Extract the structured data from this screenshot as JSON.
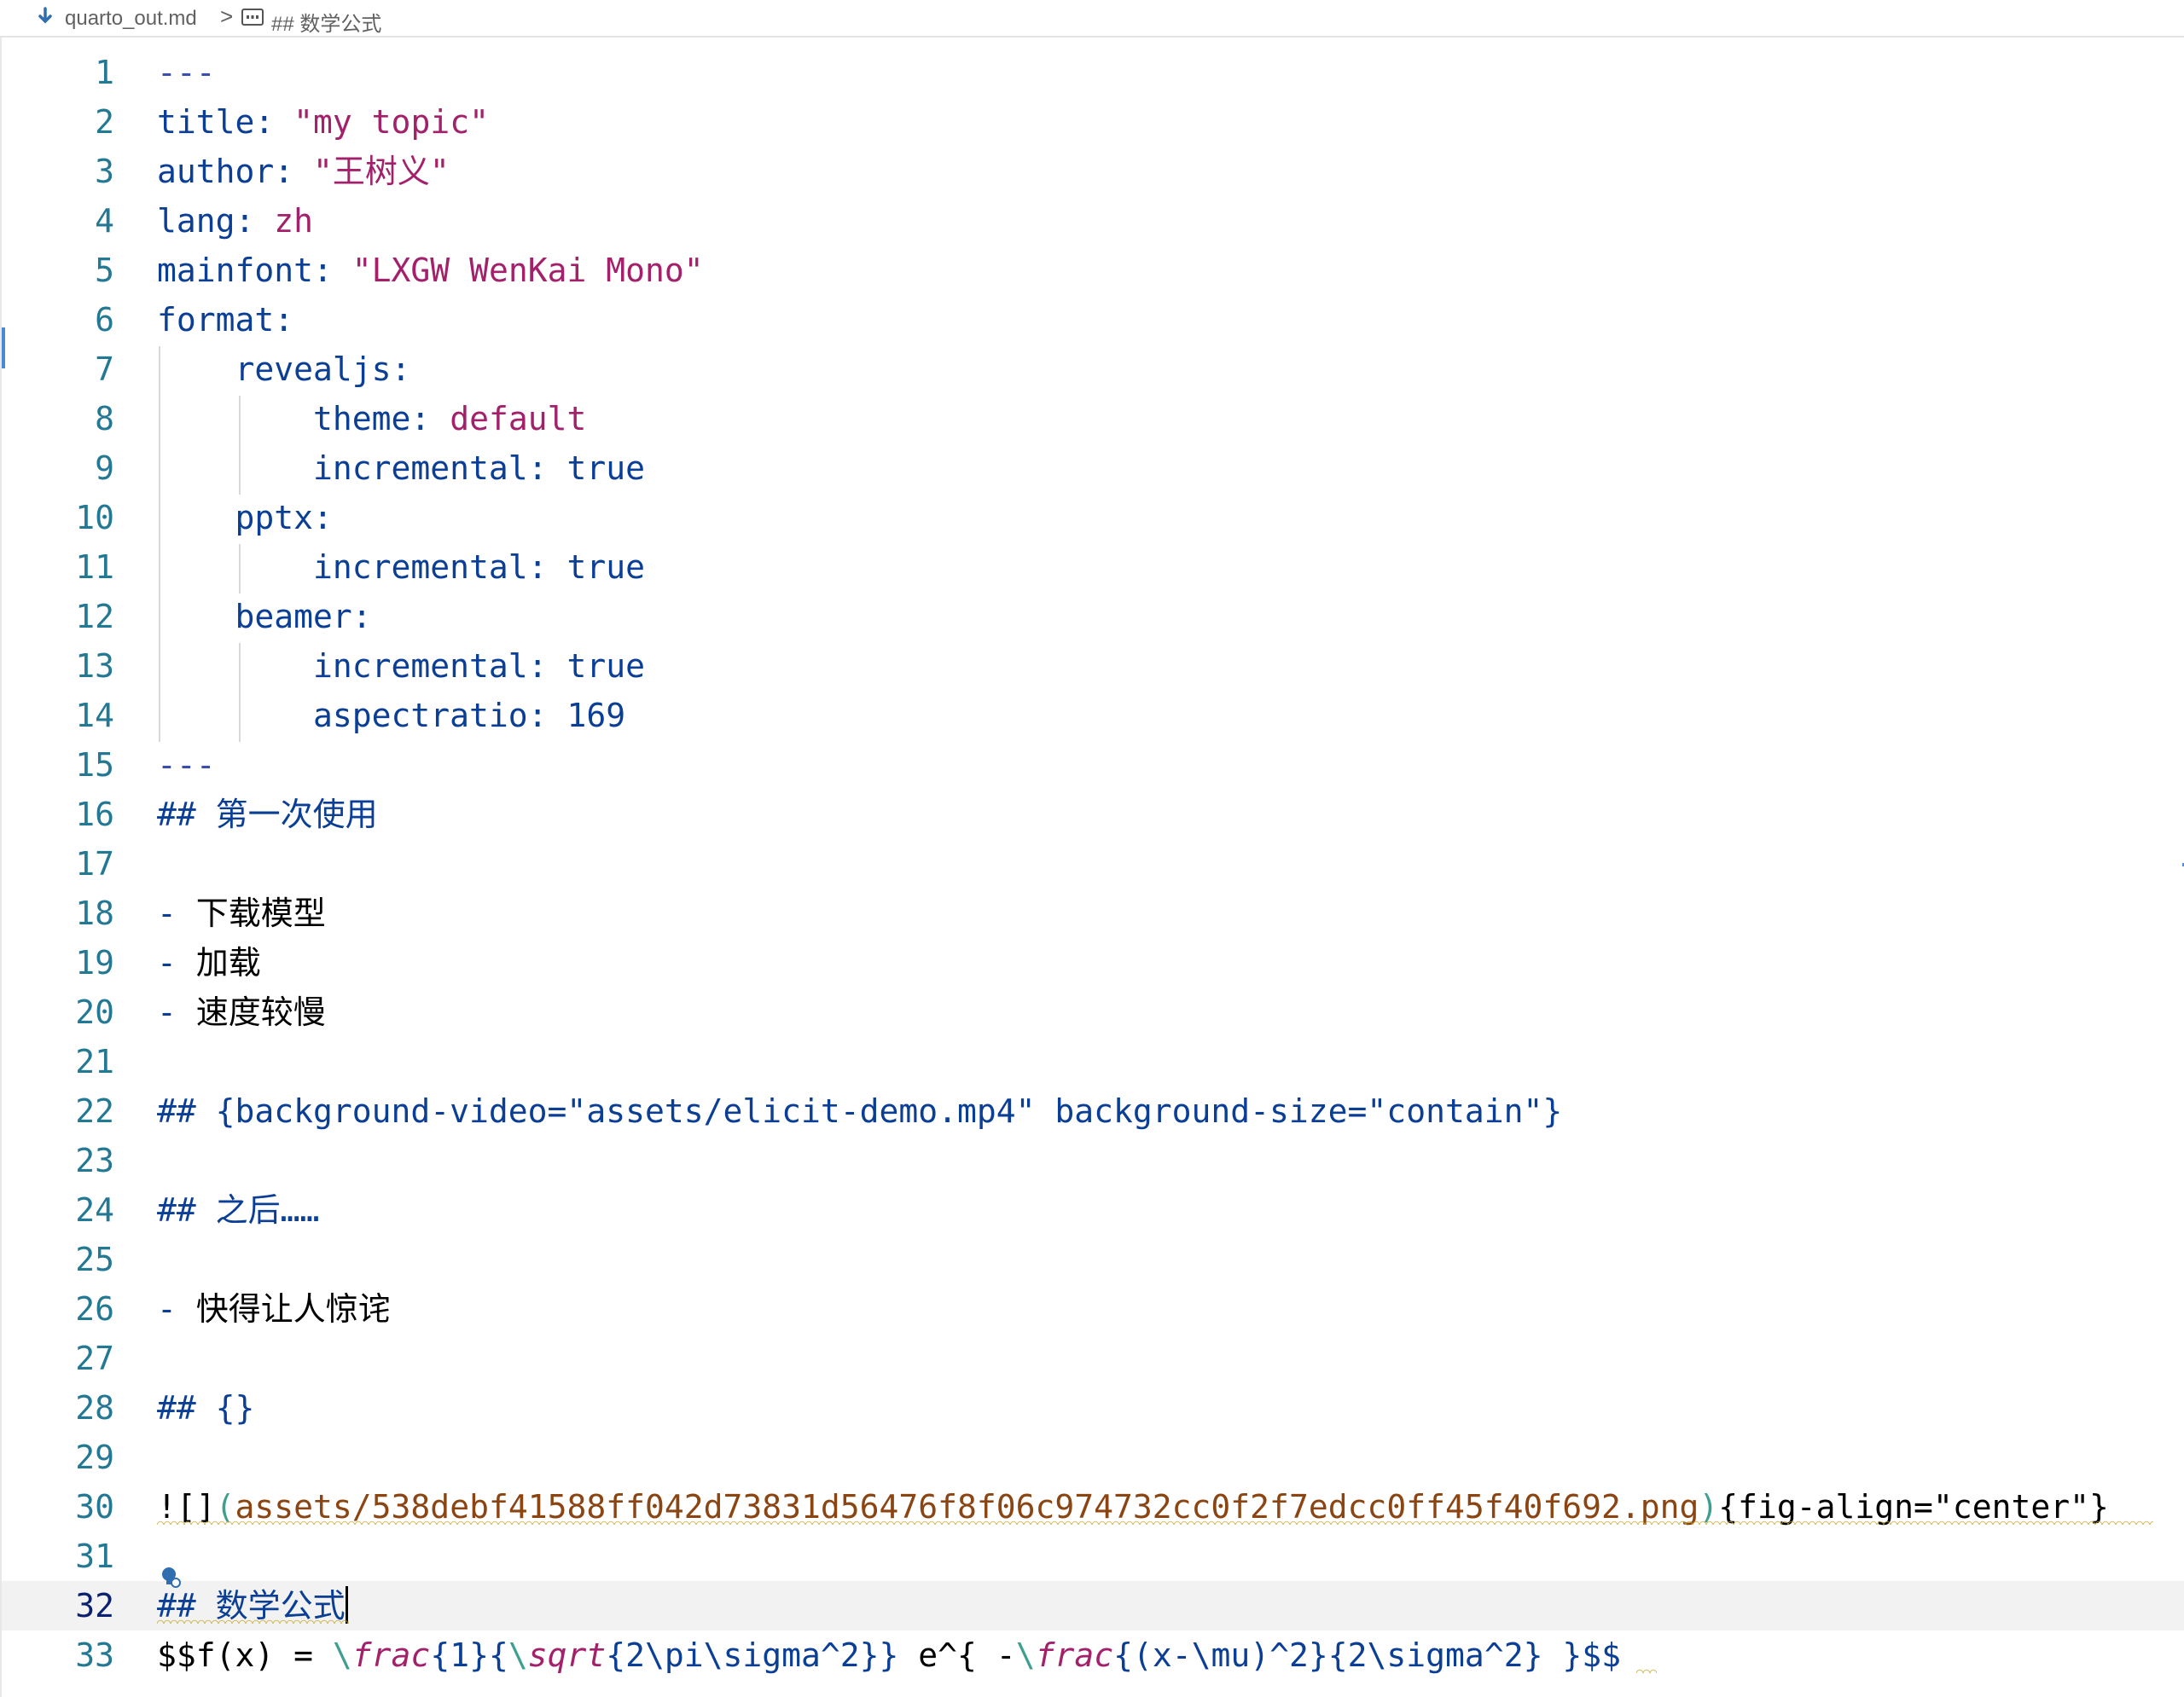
{
  "breadcrumb": {
    "file_icon": "markdown-file-icon",
    "file": "quarto_out.md",
    "separator": ">",
    "symbol_icon": "symbol-string-icon",
    "symbol": "## 数学公式"
  },
  "editor": {
    "active_line": 32,
    "lines": [
      {
        "n": 1,
        "spans": [
          {
            "t": "---",
            "c": "#3a4db0"
          }
        ]
      },
      {
        "n": 2,
        "spans": [
          {
            "t": "title:",
            "c": "#0b3e95"
          },
          {
            "t": " ",
            "c": "#000000"
          },
          {
            "t": "\"my topic\"",
            "c": "#a3216b"
          }
        ]
      },
      {
        "n": 3,
        "spans": [
          {
            "t": "author:",
            "c": "#0b3e95"
          },
          {
            "t": " ",
            "c": "#000000"
          },
          {
            "t": "\"王树义\"",
            "c": "#a3216b"
          }
        ]
      },
      {
        "n": 4,
        "spans": [
          {
            "t": "lang:",
            "c": "#0b3e95"
          },
          {
            "t": " ",
            "c": "#000000"
          },
          {
            "t": "zh",
            "c": "#a3216b"
          }
        ]
      },
      {
        "n": 5,
        "spans": [
          {
            "t": "mainfont:",
            "c": "#0b3e95"
          },
          {
            "t": " ",
            "c": "#000000"
          },
          {
            "t": "\"LXGW WenKai Mono\"",
            "c": "#a3216b"
          }
        ]
      },
      {
        "n": 6,
        "spans": [
          {
            "t": "format:",
            "c": "#0b3e95"
          }
        ]
      },
      {
        "n": 7,
        "spans": [
          {
            "t": "    ",
            "c": "#000000"
          },
          {
            "t": "revealjs:",
            "c": "#0b3e95"
          }
        ]
      },
      {
        "n": 8,
        "spans": [
          {
            "t": "        ",
            "c": "#000000"
          },
          {
            "t": "theme:",
            "c": "#0b3e95"
          },
          {
            "t": " ",
            "c": "#000000"
          },
          {
            "t": "default",
            "c": "#a3216b"
          }
        ]
      },
      {
        "n": 9,
        "spans": [
          {
            "t": "        ",
            "c": "#000000"
          },
          {
            "t": "incremental:",
            "c": "#0b3e95"
          },
          {
            "t": " ",
            "c": "#000000"
          },
          {
            "t": "true",
            "c": "#0b3e95"
          }
        ]
      },
      {
        "n": 10,
        "spans": [
          {
            "t": "    ",
            "c": "#000000"
          },
          {
            "t": "pptx:",
            "c": "#0b3e95"
          }
        ]
      },
      {
        "n": 11,
        "spans": [
          {
            "t": "        ",
            "c": "#000000"
          },
          {
            "t": "incremental:",
            "c": "#0b3e95"
          },
          {
            "t": " ",
            "c": "#000000"
          },
          {
            "t": "true",
            "c": "#0b3e95"
          }
        ]
      },
      {
        "n": 12,
        "spans": [
          {
            "t": "    ",
            "c": "#000000"
          },
          {
            "t": "beamer:",
            "c": "#0b3e95"
          }
        ]
      },
      {
        "n": 13,
        "spans": [
          {
            "t": "        ",
            "c": "#000000"
          },
          {
            "t": "incremental:",
            "c": "#0b3e95"
          },
          {
            "t": " ",
            "c": "#000000"
          },
          {
            "t": "true",
            "c": "#0b3e95"
          }
        ]
      },
      {
        "n": 14,
        "spans": [
          {
            "t": "        ",
            "c": "#000000"
          },
          {
            "t": "aspectratio:",
            "c": "#0b3e95"
          },
          {
            "t": " ",
            "c": "#000000"
          },
          {
            "t": "169",
            "c": "#0b3e95"
          }
        ]
      },
      {
        "n": 15,
        "spans": [
          {
            "t": "---",
            "c": "#3a4db0"
          }
        ]
      },
      {
        "n": 16,
        "spans": [
          {
            "t": "## 第一次使用",
            "c": "#0b3e95"
          }
        ]
      },
      {
        "n": 17,
        "spans": []
      },
      {
        "n": 18,
        "spans": [
          {
            "t": "- ",
            "c": "#0b3e95"
          },
          {
            "t": "下载模型",
            "c": "#000000"
          }
        ]
      },
      {
        "n": 19,
        "spans": [
          {
            "t": "- ",
            "c": "#0b3e95"
          },
          {
            "t": "加载",
            "c": "#000000"
          }
        ]
      },
      {
        "n": 20,
        "spans": [
          {
            "t": "- ",
            "c": "#0b3e95"
          },
          {
            "t": "速度较慢",
            "c": "#000000"
          }
        ]
      },
      {
        "n": 21,
        "spans": []
      },
      {
        "n": 22,
        "spans": [
          {
            "t": "## {background-video=\"assets/elicit-demo.mp4\" background-size=\"contain\"}",
            "c": "#0b3e95"
          }
        ]
      },
      {
        "n": 23,
        "spans": []
      },
      {
        "n": 24,
        "spans": [
          {
            "t": "## 之后……",
            "c": "#0b3e95"
          }
        ]
      },
      {
        "n": 25,
        "spans": []
      },
      {
        "n": 26,
        "spans": [
          {
            "t": "- ",
            "c": "#0b3e95"
          },
          {
            "t": "快得让人惊诧",
            "c": "#000000"
          }
        ]
      },
      {
        "n": 27,
        "spans": []
      },
      {
        "n": 28,
        "spans": [
          {
            "t": "## {}",
            "c": "#0b3e95"
          }
        ]
      },
      {
        "n": 29,
        "spans": []
      },
      {
        "n": 30,
        "spans": [
          {
            "t": "![]",
            "c": "#000000"
          },
          {
            "t": "(",
            "c": "#3f9f8f"
          },
          {
            "t": "assets/538debf41588ff042d73831d56476f8f06c974732cc0f2f7edcc0ff45f40f692.png",
            "c": "#8b4513"
          },
          {
            "t": ")",
            "c": "#3f9f8f"
          },
          {
            "t": "{fig-align=\"center\"}",
            "c": "#000000"
          }
        ]
      },
      {
        "n": 31,
        "spans": []
      },
      {
        "n": 32,
        "spans": [
          {
            "t": "## 数学公式",
            "c": "#0b3e95"
          }
        ]
      },
      {
        "n": 33,
        "spans": [
          {
            "t": "$$f(x) = ",
            "c": "#000000"
          },
          {
            "t": "\\",
            "c": "#3f9f8f"
          },
          {
            "t": "frac",
            "c": "#a3216b",
            "i": true
          },
          {
            "t": "{1}{",
            "c": "#0b3e95"
          },
          {
            "t": "\\",
            "c": "#3f9f8f"
          },
          {
            "t": "sqrt",
            "c": "#a3216b",
            "i": true
          },
          {
            "t": "{2",
            "c": "#0b3e95"
          },
          {
            "t": "\\pi\\sigma",
            "c": "#0b3e95"
          },
          {
            "t": "^2}}",
            "c": "#0b3e95"
          },
          {
            "t": " e^{ -",
            "c": "#000000"
          },
          {
            "t": "\\",
            "c": "#3f9f8f"
          },
          {
            "t": "frac",
            "c": "#a3216b",
            "i": true
          },
          {
            "t": "{(x-",
            "c": "#0b3e95"
          },
          {
            "t": "\\mu",
            "c": "#0b3e95"
          },
          {
            "t": ")^2}{2",
            "c": "#0b3e95"
          },
          {
            "t": "\\sigma",
            "c": "#0b3e95"
          },
          {
            "t": "^2} }$$",
            "c": "#0b3e95"
          }
        ]
      }
    ]
  }
}
